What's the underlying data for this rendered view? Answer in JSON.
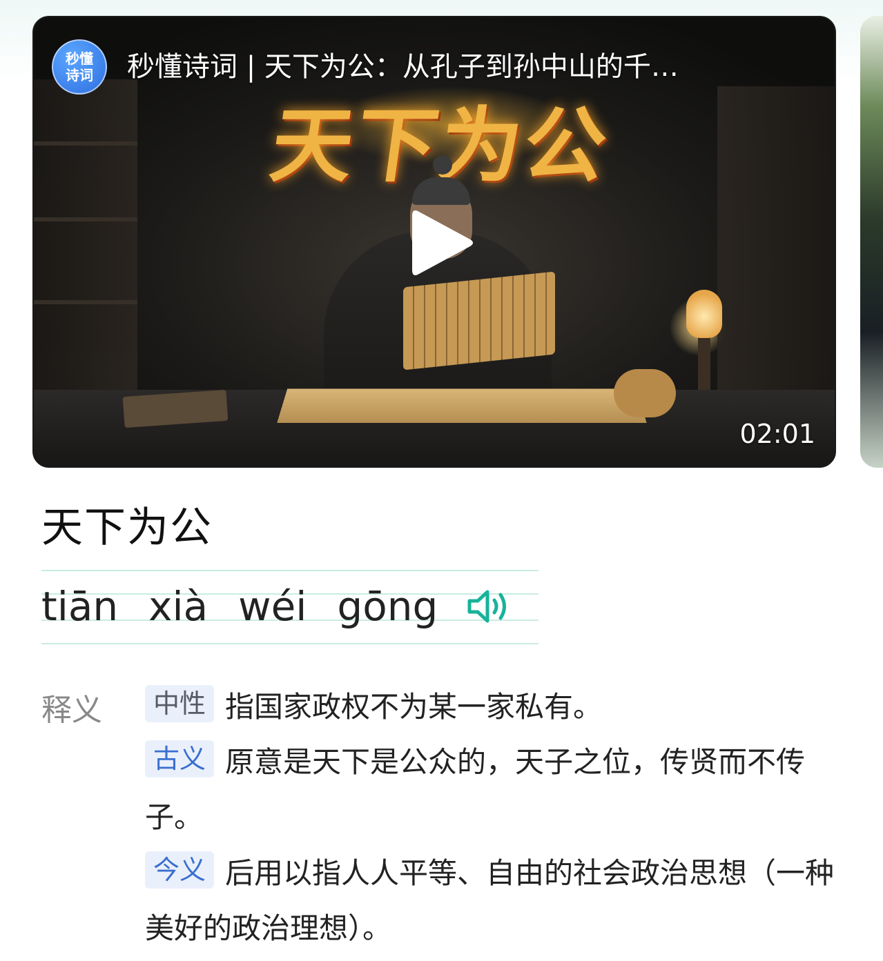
{
  "video": {
    "channel_logo_text": "秒懂\n诗词",
    "title": "秒懂诗词 | 天下为公：从孔子到孙中山的千…",
    "banner_text": "天下为公",
    "duration": "02:01"
  },
  "entry": {
    "word": "天下为公",
    "pinyin": [
      "tiān",
      "xià",
      "wéi",
      "gōng"
    ],
    "meaning_label": "释义",
    "senses": [
      {
        "tag": "中性",
        "text": "指国家政权不为某一家私有。"
      },
      {
        "tag": "古义",
        "text": "原意是天下是公众的，天子之位，传贤而不传子。"
      },
      {
        "tag": "今义",
        "text": "后用以指人人平等、自由的社会政治思想（一种美好的政治理想）。"
      }
    ]
  },
  "colors": {
    "accent_teal": "#17b39a",
    "tag_blue": "#3a6fcf",
    "tag_bg": "#eaf0fb"
  }
}
